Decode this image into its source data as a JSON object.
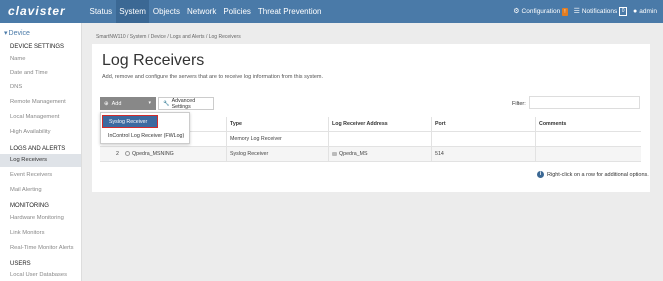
{
  "app": {
    "logo_text": "clavister"
  },
  "nav": {
    "items": [
      {
        "label": "Status"
      },
      {
        "label": "System"
      },
      {
        "label": "Objects"
      },
      {
        "label": "Network"
      },
      {
        "label": "Policies"
      },
      {
        "label": "Threat Prevention"
      }
    ],
    "active": "System"
  },
  "topright": {
    "configuration_label": "Configuration",
    "configuration_badge": "!",
    "notifications_label": "Notifications",
    "notifications_count": "0",
    "user_label": "admin"
  },
  "sidebar": {
    "head": "Device",
    "groups": [
      {
        "title": "DEVICE SETTINGS",
        "items": [
          "Name",
          "Date and Time",
          "DNS",
          "Remote Management",
          "Local Management",
          "High Availability"
        ]
      },
      {
        "title": "LOGS AND ALERTS",
        "items": [
          "Log Receivers",
          "Event Receivers",
          "Mail Alerting"
        ]
      },
      {
        "title": "MONITORING",
        "items": [
          "Hardware Monitoring",
          "Link Monitors",
          "Real-Time Monitor Alerts"
        ]
      },
      {
        "title": "USERS",
        "items": [
          "Local User Databases"
        ]
      }
    ],
    "active_item": "Log Receivers"
  },
  "breadcrumb": "SmartNW110  /  System  /  Device  /  Logs and Alerts  /  Log Receivers",
  "page": {
    "title": "Log Receivers",
    "description": "Add, remove and configure the servers that are to receive log information from this system."
  },
  "toolbar": {
    "add_label": "Add",
    "advanced_label": "Advanced Settings",
    "filter_label": "Filter:",
    "filter_value": ""
  },
  "dropdown": {
    "items": [
      "Syslog Receiver",
      "InControl Log Receiver (FWLog)"
    ]
  },
  "table": {
    "headers": [
      "",
      "",
      "Type",
      "Log Receiver Address",
      "Port",
      "Comments"
    ],
    "rows": [
      {
        "num": "",
        "name": "",
        "type": "Memory Log Receiver",
        "address": "",
        "port": "",
        "comments": ""
      },
      {
        "num": "2",
        "name": "Qpedra_MSNING",
        "type": "Syslog Receiver",
        "address": "Qpedra_MS",
        "port": "514",
        "comments": ""
      }
    ]
  },
  "hint": "Right-click on a row for additional options.",
  "colors": {
    "topbar": "#4a7aa8",
    "accent": "#3b6894",
    "badge": "#e27d22",
    "highlight": "#d12c2c"
  }
}
